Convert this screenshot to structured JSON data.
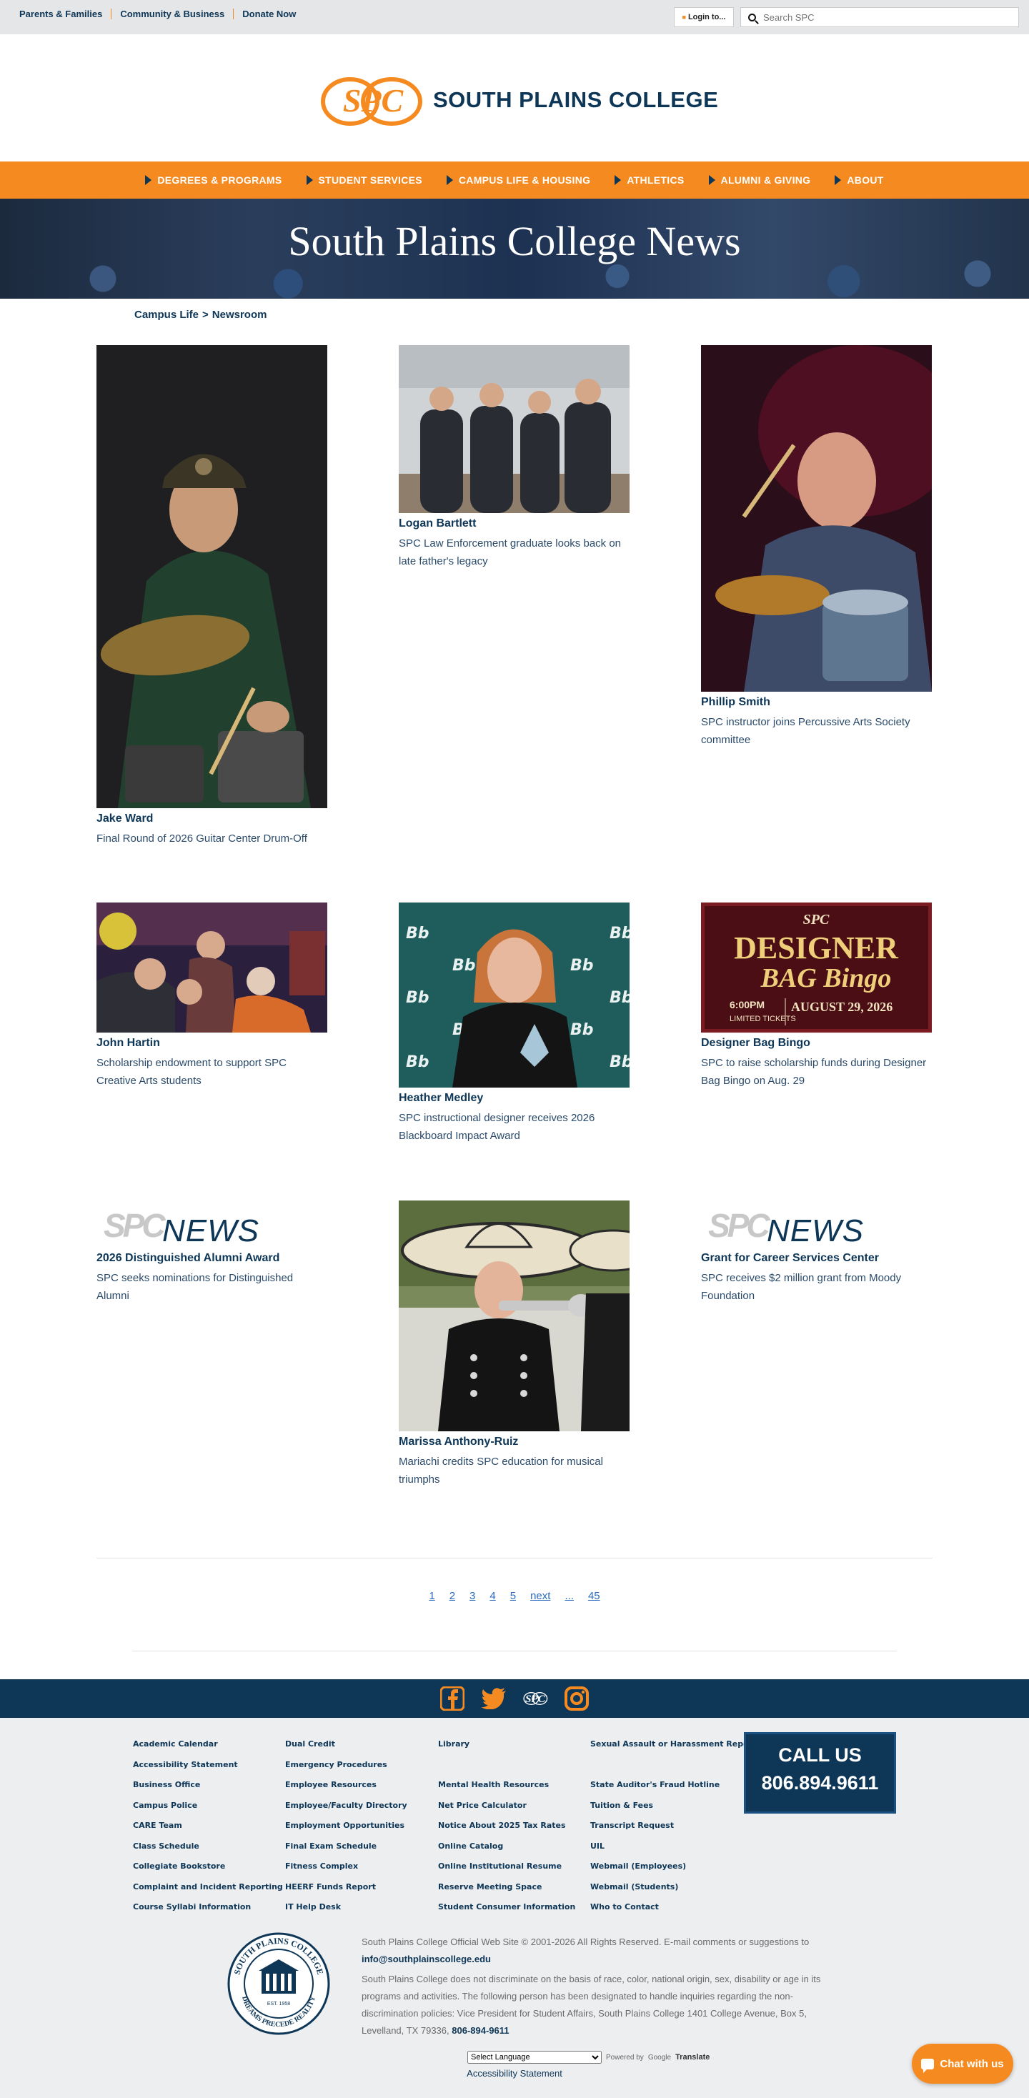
{
  "utility_links": [
    "Parents & Families",
    "Community & Business",
    "Donate Now"
  ],
  "login_label": "Login to...",
  "search": {
    "placeholder": "Search SPC"
  },
  "logo": {
    "text": "SOUTH PLAINS COLLEGE",
    "mark": "SPC"
  },
  "nav": [
    "DEGREES & PROGRAMS",
    "STUDENT SERVICES",
    "CAMPUS LIFE & HOUSING",
    "ATHLETICS",
    "ALUMNI & GIVING",
    "ABOUT"
  ],
  "hero": {
    "title": "South Plains College News"
  },
  "breadcrumb": {
    "parent": "Campus Life",
    "separator": ">",
    "current": "Newsroom"
  },
  "articles": [
    {
      "name": "Jake Ward",
      "desc": "Final Round of 2026 Guitar Center Drum-Off",
      "image": "photo"
    },
    {
      "name": "Logan Bartlett",
      "desc": "SPC Law Enforcement graduate looks back on late father's legacy",
      "image": "photo"
    },
    {
      "name": "Phillip Smith",
      "desc": "SPC instructor joins Percussive Arts Society committee",
      "image": "photo"
    },
    {
      "name": "John Hartin",
      "desc": "Scholarship endowment to support SPC Creative Arts students",
      "image": "photo"
    },
    {
      "name": "Heather Medley",
      "desc": "SPC instructional designer receives 2026 Blackboard Impact Award",
      "image": "photo",
      "backdrop_text": "Bb"
    },
    {
      "name": "Designer Bag Bingo",
      "desc": "SPC to raise scholarship funds during Designer Bag Bingo on Aug. 29",
      "image": "poster",
      "poster": {
        "top": "SPC",
        "title": "DESIGNER",
        "subtitle": "BAG Bingo",
        "time": "6:00PM",
        "date": "AUGUST 29, 2026",
        "tickets": "LIMITED TICKETS"
      }
    },
    {
      "name": "2026 Distinguished Alumni Award",
      "desc": "SPC seeks nominations for Distinguished Alumni",
      "image": "news-logo",
      "logo_text": "NEWS"
    },
    {
      "name": "Marissa Anthony-Ruiz",
      "desc": "Mariachi credits SPC education for musical triumphs",
      "image": "photo"
    },
    {
      "name": "Grant for Career Services Center",
      "desc": "SPC receives $2 million grant from Moody Foundation",
      "image": "news-logo",
      "logo_text": "NEWS"
    }
  ],
  "pagination": [
    "1",
    "2",
    "3",
    "4",
    "5",
    "next",
    "...",
    "45"
  ],
  "social": [
    "facebook-icon",
    "twitter-icon",
    "spc-icon",
    "instagram-icon"
  ],
  "footer": {
    "col1": [
      "Academic Calendar",
      "Accessibility Statement",
      "Business Office",
      "Campus Police",
      "CARE Team",
      "Class Schedule",
      "Collegiate Bookstore",
      "Complaint and Incident Reporting",
      "Course Syllabi Information"
    ],
    "col2": [
      "Dual Credit",
      "Emergency Procedures",
      "Employee Resources",
      "Employee/Faculty Directory",
      "Employment Opportunities",
      "Final Exam Schedule",
      "Fitness Complex",
      "HEERF Funds Report",
      "IT Help Desk"
    ],
    "col3": [
      "Library",
      "",
      "Mental Health Resources",
      "Net Price Calculator",
      "Notice About 2025 Tax Rates",
      "Online Catalog",
      "Online Institutional Resume",
      "Reserve Meeting Space",
      "Student Consumer Information"
    ],
    "col4": [
      "Sexual Assault or Harassment Reporting",
      "",
      "State Auditor's Fraud Hotline",
      "Tuition & Fees",
      "Transcript Request",
      "UIL",
      "Webmail (Employees)",
      "Webmail (Students)",
      "Who to Contact"
    ],
    "call_label": "CALL US",
    "call_number": "806.894.9611",
    "seal": {
      "top": "SOUTH PLAINS COLLEGE",
      "bottom": "DREAMS PRECEDE REALITY",
      "est": "EST. 1958"
    },
    "copyright": "South Plains College Official Web Site © 2001-2026 All Rights Reserved. E-mail comments or suggestions to",
    "email": "info@southplainscollege.edu",
    "nondiscrimination": "South Plains College does not discriminate on the basis of race, color, national origin, sex, disability or age in its programs and activities. The following person has been designated to handle inquiries regarding the non-discrimination policies: Vice President for Student Affairs, South Plains College 1401 College Avenue, Box 5, Levelland, TX 79336,",
    "phone": "806-894-9611",
    "language_select": "Select Language",
    "powered_by": "Powered by",
    "google": "Google",
    "translate": "Translate",
    "accessibility": "Accessibility Statement"
  },
  "chat_label": "Chat with us",
  "colors": {
    "navy": "#0d3657",
    "orange": "#f58a20"
  }
}
